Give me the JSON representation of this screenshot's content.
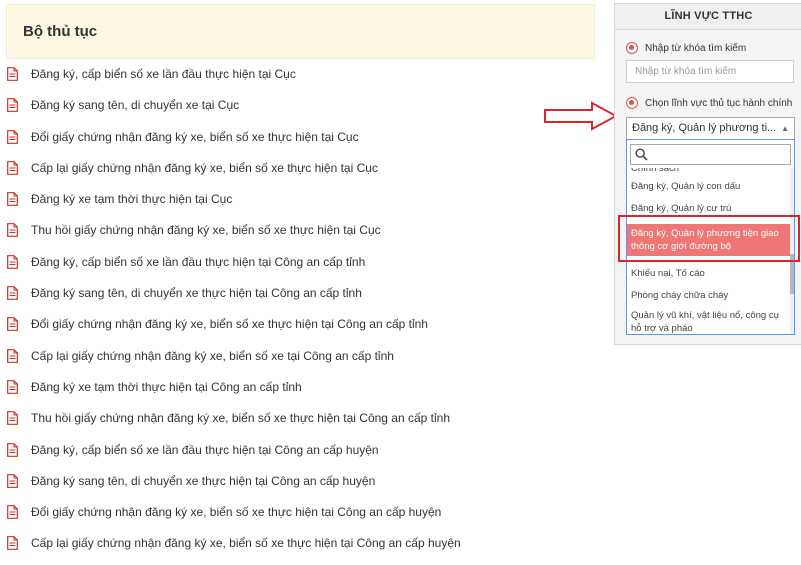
{
  "header": {
    "title": "Bộ thủ tục"
  },
  "procedures": [
    "Đăng ký, cấp biển số xe lần đầu thực hiện tại Cục",
    "Đăng ký sang tên, di chuyển xe tại Cục",
    "Đổi giấy chứng nhận đăng ký xe, biển số xe thực hiện tại Cục",
    "Cấp lại giấy chứng nhận đăng ký xe, biển số xe thực hiện tại Cục",
    "Đăng ký xe tạm thời thực hiện tại Cục",
    "Thu hồi giấy chứng nhận đăng ký xe, biển số xe thực hiện tại Cục",
    "Đăng ký, cấp biển số xe lần đầu thực hiện tại Công an cấp tỉnh",
    "Đăng ký sang tên, di chuyển xe thực hiện tại Công an cấp tỉnh",
    "Đổi giấy chứng nhận đăng ký xe, biển số xe thực hiện tại Công an cấp tỉnh",
    "Cấp lại giấy chứng nhận đăng ký xe, biển số xe tại Công an cấp tỉnh",
    "Đăng ký xe tạm thời thực hiện tại Công an cấp tỉnh",
    "Thu hồi giấy chứng nhận đăng ký xe, biển số xe thực hiện tại Công an cấp tỉnh",
    "Đăng ký, cấp biển số xe lần đầu thực hiện tại Công an cấp huyện",
    "Đăng ký sang tên, di chuyển xe thực hiện tại Công an cấp huyện",
    "Đổi giấy chứng nhận đăng ký xe, biển số xe thực hiện tại Công an cấp huyện",
    "Cấp lại giấy chứng nhận đăng ký xe, biển số xe thực hiện tại Công an cấp huyện"
  ],
  "panel": {
    "title": "LĨNH VỰC TTHC",
    "radio_keyword_label": "Nhập từ khóa tìm kiếm",
    "keyword_placeholder": "Nhập từ khóa tìm kiếm",
    "radio_field_label": "Chọn lĩnh vực thủ tục hành chính",
    "selected_value": "Đăng ký, Quản lý phương ti...",
    "options": [
      "Chính sách",
      "Đăng ký, Quản lý con dấu",
      "Đăng ký, Quản lý cư trú",
      "Đăng ký, Quản lý phương tiện giao thông cơ giới đường bộ",
      "Khiếu nại, Tố cáo",
      "Phòng cháy chữa cháy",
      "Quản lý vũ khí, vật liệu nổ, công cụ hỗ trợ và pháo"
    ],
    "selected_index": 3
  },
  "colors": {
    "accent_red": "#d9534f",
    "highlight_border": "#d9262c",
    "selected_option_bg": "#ee7775",
    "header_bg": "#fcf8e3"
  },
  "icons": {
    "procedure_icon": "pdf-file-icon",
    "search_icon": "search-icon",
    "arrow_icon": "arrow-right-icon"
  }
}
